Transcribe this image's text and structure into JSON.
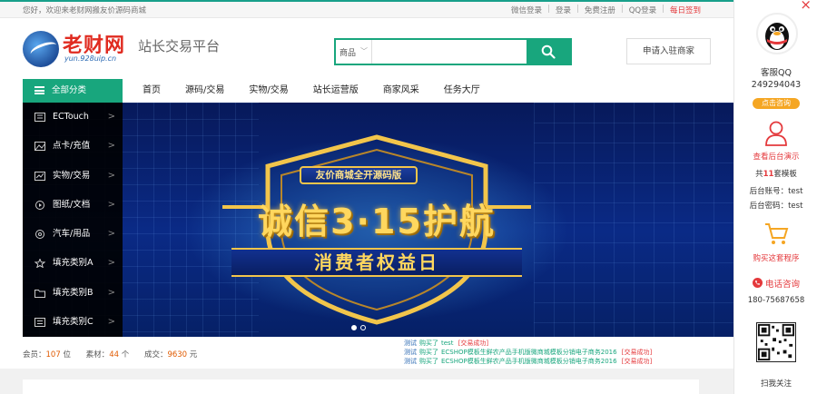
{
  "topbar": {
    "welcome": "您好，欢迎来老财网搬友价源码商城",
    "links": [
      "微信登录",
      "登录",
      "免费注册",
      "QQ登录"
    ],
    "signin": "每日签到"
  },
  "header": {
    "logo_text": "老财网",
    "logo_domain": "yun.928uip.cn",
    "slogan": "站长交易平台",
    "search_select": "商品",
    "search_placeholder": "",
    "apply_button": "申请入驻商家"
  },
  "nav": {
    "all_categories": "全部分类",
    "items": [
      "首页",
      "源码/交易",
      "实物/交易",
      "站长运营版",
      "商家风采",
      "任务大厅"
    ]
  },
  "categories": [
    {
      "label": "ECTouch",
      "icon": "grid-icon"
    },
    {
      "label": "点卡/充值",
      "icon": "image-icon"
    },
    {
      "label": "实物/交易",
      "icon": "chart-icon"
    },
    {
      "label": "图纸/文档",
      "icon": "play-icon"
    },
    {
      "label": "汽车/用品",
      "icon": "wheel-icon"
    },
    {
      "label": "填充类别A",
      "icon": "star-icon"
    },
    {
      "label": "填充类别B",
      "icon": "folder-icon"
    },
    {
      "label": "填充类别C",
      "icon": "list-icon"
    }
  ],
  "banner": {
    "tag": "友价商城全开源码版",
    "headline": "诚信3·15护航",
    "sub": "消费者权益日",
    "slides": 2,
    "active_slide": 1
  },
  "stats": {
    "members_label": "会员：",
    "members_value": "107",
    "members_unit": "位",
    "materials_label": "素材：",
    "materials_value": "44",
    "materials_unit": "个",
    "deals_label": "成交：",
    "deals_value": "9630",
    "deals_unit": "元"
  },
  "ticker": [
    {
      "user": "测试",
      "action": "购买了",
      "item": "test",
      "status": "[交易成功]"
    },
    {
      "user": "测试",
      "action": "购买了",
      "item": "ECSHOP模板生鲜农产品手机版微商城模板分销电子商务2016",
      "status": "[交易成功]"
    },
    {
      "user": "测试",
      "action": "购买了",
      "item": "ECSHOP模板生鲜农产品手机版微商城模板分销电子商务2016",
      "status": "[交易成功]"
    }
  ],
  "rpanel": {
    "close": "×",
    "qq_label": "客服QQ",
    "qq_number": "249294043",
    "consult_button": "点击咨询",
    "demo_label": "查看后台演示",
    "templates_prefix": "共",
    "templates_count": "11",
    "templates_suffix": "套模板",
    "admin_account": "后台账号：test",
    "admin_password": "后台密码：test",
    "buy_label": "购买这套程序",
    "phone_label": "电话咨询",
    "phone_number": "180-75687658",
    "scan_label": "扫我关注"
  }
}
